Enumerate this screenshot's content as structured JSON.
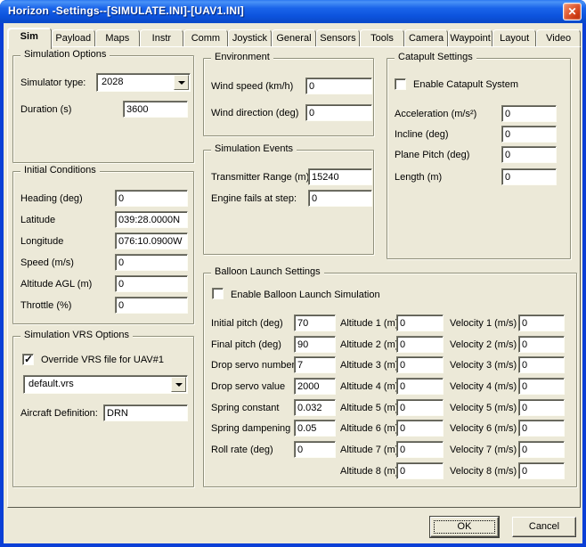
{
  "window": {
    "title": "Horizon -Settings--[SIMULATE.INI]-[UAV1.INI]",
    "close_glyph": "✕"
  },
  "tabs": {
    "selected": "Sim",
    "items": [
      "Sim",
      "Payload",
      "Maps",
      "Instr",
      "Comm",
      "Joystick",
      "General",
      "Sensors",
      "Tools",
      "Camera",
      "Waypoint",
      "Layout",
      "Video"
    ]
  },
  "simulation_options": {
    "title": "Simulation Options",
    "simulator_type": {
      "label": "Simulator type:",
      "value": "2028"
    },
    "duration": {
      "label": "Duration (s)",
      "value": "3600"
    }
  },
  "initial_conditions": {
    "title": "Initial Conditions",
    "fields": [
      {
        "label": "Heading (deg)",
        "value": "0"
      },
      {
        "label": "Latitude",
        "value": "039:28.0000N"
      },
      {
        "label": "Longitude",
        "value": "076:10.0900W"
      },
      {
        "label": "Speed (m/s)",
        "value": "0"
      },
      {
        "label": "Altitude AGL (m)",
        "value": "0"
      },
      {
        "label": "Throttle (%)",
        "value": "0"
      }
    ]
  },
  "vrs_options": {
    "title": "Simulation VRS Options",
    "override_checkbox": {
      "label": "Override VRS file for UAV#1",
      "checked": true
    },
    "vrs_file": {
      "value": "default.vrs"
    },
    "aircraft_definition": {
      "label": "Aircraft Definition:",
      "value": "DRN"
    }
  },
  "environment": {
    "title": "Environment",
    "fields": [
      {
        "label": "Wind speed (km/h)",
        "value": "0"
      },
      {
        "label": "Wind direction (deg)",
        "value": "0"
      }
    ]
  },
  "simulation_events": {
    "title": "Simulation Events",
    "fields": [
      {
        "label": "Transmitter Range (m):",
        "value": "15240"
      },
      {
        "label": "Engine fails at step:",
        "value": "0"
      }
    ]
  },
  "catapult": {
    "title": "Catapult Settings",
    "enable_checkbox": {
      "label": "Enable Catapult System",
      "checked": false
    },
    "fields": [
      {
        "label": "Acceleration (m/s²)",
        "value": "0"
      },
      {
        "label": "Incline (deg)",
        "value": "0"
      },
      {
        "label": "Plane Pitch (deg)",
        "value": "0"
      },
      {
        "label": "Length (m)",
        "value": "0"
      }
    ]
  },
  "balloon": {
    "title": "Balloon Launch Settings",
    "enable_checkbox": {
      "label": "Enable Balloon Launch Simulation",
      "checked": false
    },
    "params": [
      {
        "label": "Initial pitch (deg)",
        "value": "70"
      },
      {
        "label": "Final pitch (deg)",
        "value": "90"
      },
      {
        "label": "Drop servo number",
        "value": "7"
      },
      {
        "label": "Drop servo value",
        "value": "2000"
      },
      {
        "label": "Spring constant",
        "value": "0.032"
      },
      {
        "label": "Spring dampening",
        "value": "0.05"
      },
      {
        "label": "Roll rate (deg)",
        "value": "0"
      }
    ],
    "altitudes": [
      {
        "label": "Altitude 1 (m)",
        "value": "0"
      },
      {
        "label": "Altitude 2 (m)",
        "value": "0"
      },
      {
        "label": "Altitude 3 (m)",
        "value": "0"
      },
      {
        "label": "Altitude 4 (m)",
        "value": "0"
      },
      {
        "label": "Altitude 5 (m)",
        "value": "0"
      },
      {
        "label": "Altitude 6 (m)",
        "value": "0"
      },
      {
        "label": "Altitude 7 (m)",
        "value": "0"
      },
      {
        "label": "Altitude 8 (m)",
        "value": "0"
      }
    ],
    "velocities": [
      {
        "label": "Velocity 1 (m/s)",
        "value": "0"
      },
      {
        "label": "Velocity 2 (m/s)",
        "value": "0"
      },
      {
        "label": "Velocity 3 (m/s)",
        "value": "0"
      },
      {
        "label": "Velocity 4 (m/s)",
        "value": "0"
      },
      {
        "label": "Velocity 5 (m/s)",
        "value": "0"
      },
      {
        "label": "Velocity 6 (m/s)",
        "value": "0"
      },
      {
        "label": "Velocity 7 (m/s)",
        "value": "0"
      },
      {
        "label": "Velocity 8 (m/s)",
        "value": "0"
      }
    ]
  },
  "footer": {
    "ok_label": "OK",
    "cancel_label": "Cancel"
  },
  "colors": {
    "titlebar_blue": "#0c53dd",
    "window_border": "#0b3fd6",
    "dialog_face": "#ece9d8",
    "close_red": "#cc3912"
  }
}
